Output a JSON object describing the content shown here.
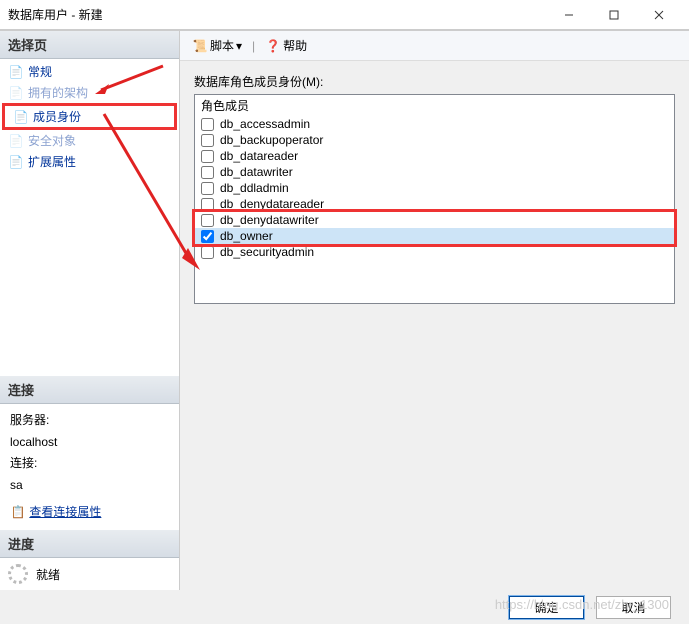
{
  "window": {
    "title": "数据库用户 - 新建"
  },
  "sidebar": {
    "select_header": "选择页",
    "items": [
      {
        "label": "常规"
      },
      {
        "label": "拥有的架构"
      },
      {
        "label": "成员身份"
      },
      {
        "label": "安全对象"
      },
      {
        "label": "扩展属性"
      }
    ],
    "conn_header": "连接",
    "server_label": "服务器:",
    "server_value": "localhost",
    "auth_label": "连接:",
    "auth_value": "sa",
    "conn_link": "查看连接属性",
    "progress_header": "进度",
    "progress_status": "就绪"
  },
  "toolbar": {
    "script_label": "脚本",
    "help_label": "帮助"
  },
  "main": {
    "field_label": "数据库角色成员身份(M):",
    "roles_header": "角色成员",
    "roles": [
      {
        "name": "db_accessadmin",
        "checked": false
      },
      {
        "name": "db_backupoperator",
        "checked": false
      },
      {
        "name": "db_datareader",
        "checked": false
      },
      {
        "name": "db_datawriter",
        "checked": false
      },
      {
        "name": "db_ddladmin",
        "checked": false
      },
      {
        "name": "db_denydatareader",
        "checked": false
      },
      {
        "name": "db_denydatawriter",
        "checked": false
      },
      {
        "name": "db_owner",
        "checked": true
      },
      {
        "name": "db_securityadmin",
        "checked": false
      }
    ]
  },
  "footer": {
    "ok": "确定",
    "cancel": "取消"
  },
  "watermark": "https://blog.csdn.net/zhr_1300"
}
